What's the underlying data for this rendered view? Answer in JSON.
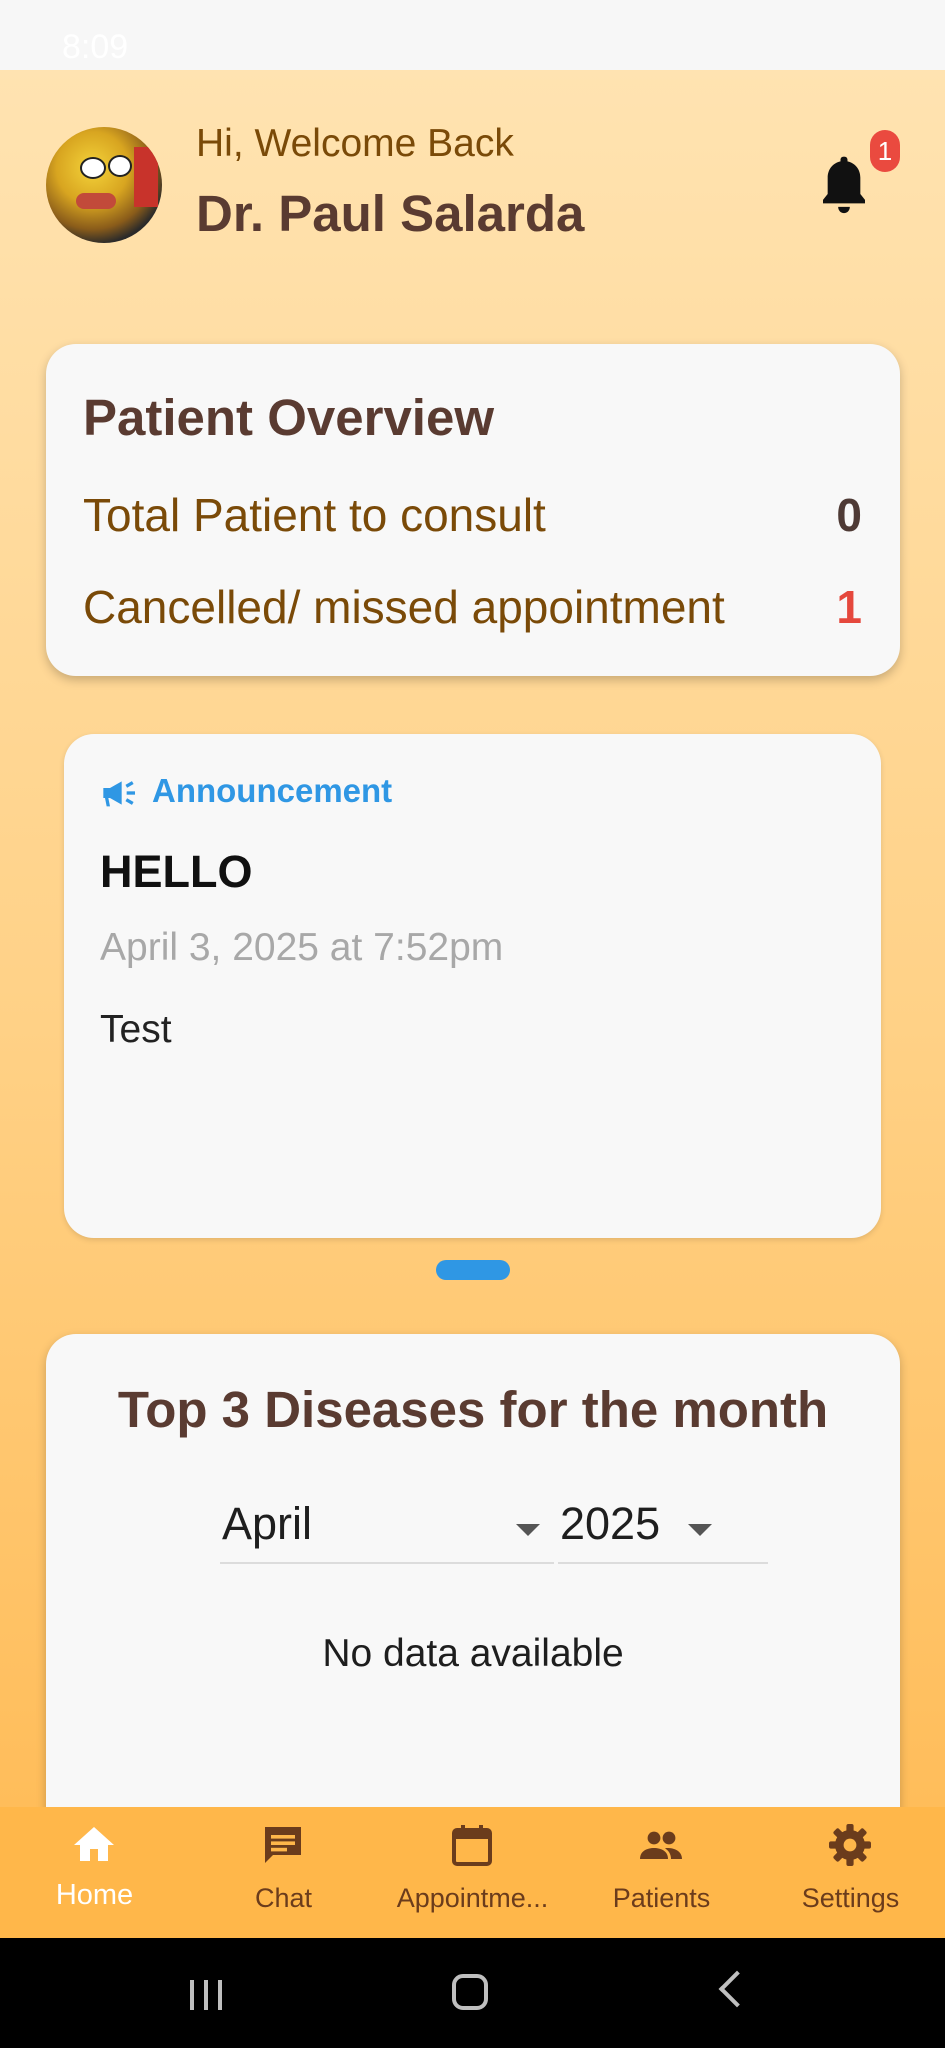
{
  "status_bar": {
    "time": "8:09"
  },
  "header": {
    "greeting": "Hi, Welcome Back",
    "doctor_name": "Dr. Paul Salarda",
    "notification_count": "1"
  },
  "overview": {
    "title": "Patient Overview",
    "rows": [
      {
        "label": "Total Patient to consult",
        "value": "0"
      },
      {
        "label": "Cancelled/ missed appointment",
        "value": "1"
      }
    ]
  },
  "announcement": {
    "heading": "Announcement",
    "title": "HELLO",
    "date": "April 3, 2025 at 7:52pm",
    "body": "Test"
  },
  "diseases": {
    "title": "Top 3 Diseases for the month",
    "month": "April",
    "year": "2025",
    "empty_text": "No data available"
  },
  "bottom_nav": {
    "items": [
      {
        "label": "Home",
        "icon": "home-icon",
        "active": true
      },
      {
        "label": "Chat",
        "icon": "chat-icon"
      },
      {
        "label": "Appointme...",
        "icon": "calendar-icon"
      },
      {
        "label": "Patients",
        "icon": "people-icon"
      },
      {
        "label": "Settings",
        "icon": "gear-icon"
      }
    ]
  },
  "colors": {
    "accent_blue": "#2f97e4",
    "brown_text": "#5a3b31",
    "alert_red": "#e5483d",
    "nav_bg": "#ffb74a"
  }
}
